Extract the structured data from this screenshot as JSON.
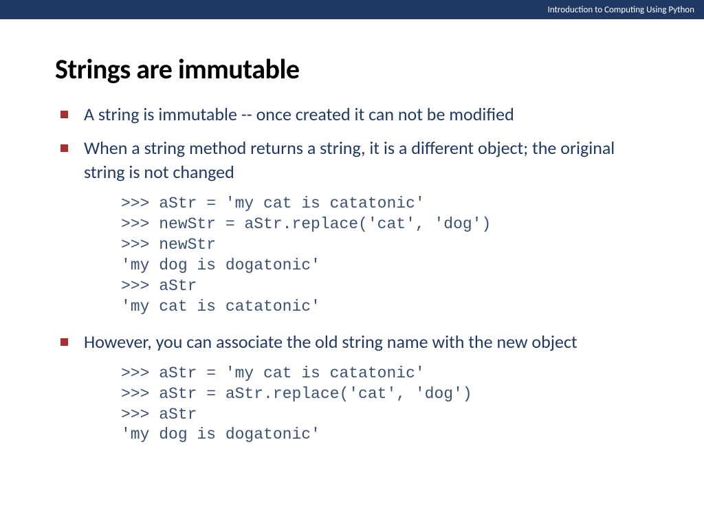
{
  "header": {
    "subtitle": "Introduction to Computing Using Python"
  },
  "title": "Strings are immutable",
  "bullets": {
    "b1": "A string is immutable -- once created it can not be modified",
    "b2": "When a string method returns a string, it is a different object; the original string is not changed",
    "b3": "However, you can associate the old string name with the new object"
  },
  "code": {
    "block1": ">>> aStr = 'my cat is catatonic'\n>>> newStr = aStr.replace('cat', 'dog')\n>>> newStr\n'my dog is dogatonic'\n>>> aStr\n'my cat is catatonic'",
    "block2": ">>> aStr = 'my cat is catatonic'\n>>> aStr = aStr.replace('cat', 'dog')\n>>> aStr\n'my dog is dogatonic'"
  }
}
